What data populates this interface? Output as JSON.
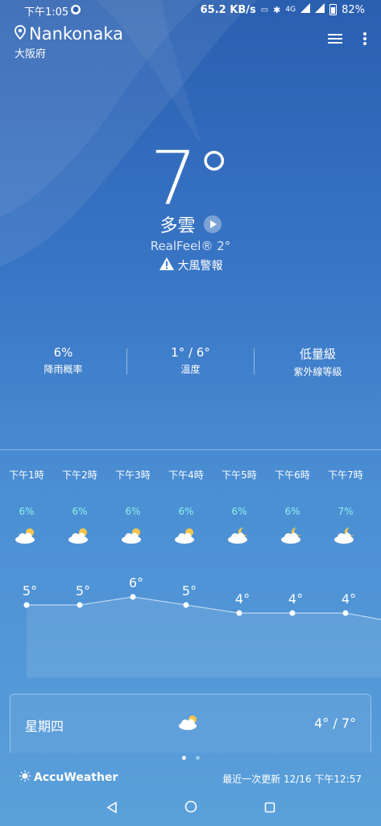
{
  "status_bar": {
    "time": "下午1:05",
    "net_speed": "65.2 KB/s",
    "signal_1": "4G",
    "battery": "82%"
  },
  "location": {
    "name": "Nankonaka",
    "region": "大阪府"
  },
  "current": {
    "temperature": "7°",
    "condition": "多雲",
    "realfeel": "RealFeel® 2°",
    "alert": "大風警報"
  },
  "stats": [
    {
      "value": "6%",
      "label": "降雨概率"
    },
    {
      "value": "1° / 6°",
      "label": "溫度"
    },
    {
      "value": "低量級",
      "label": "紫外線等級"
    }
  ],
  "hourly": [
    {
      "time": "下午1時",
      "precip": "6%",
      "icon": "partly-cloudy-day-icon",
      "temp": "5°",
      "value": 5
    },
    {
      "time": "下午2時",
      "precip": "6%",
      "icon": "partly-cloudy-day-icon",
      "temp": "5°",
      "value": 5
    },
    {
      "time": "下午3時",
      "precip": "6%",
      "icon": "partly-cloudy-day-icon",
      "temp": "6°",
      "value": 6
    },
    {
      "time": "下午4時",
      "precip": "6%",
      "icon": "partly-cloudy-day-icon",
      "temp": "5°",
      "value": 5
    },
    {
      "time": "下午5時",
      "precip": "6%",
      "icon": "partly-cloudy-night-icon",
      "temp": "4°",
      "value": 4
    },
    {
      "time": "下午6時",
      "precip": "6%",
      "icon": "partly-cloudy-night-icon",
      "temp": "4°",
      "value": 4
    },
    {
      "time": "下午7時",
      "precip": "7%",
      "icon": "partly-cloudy-night-icon",
      "temp": "4°",
      "value": 4
    }
  ],
  "daily": {
    "day": "星期四",
    "icon": "partly-cloudy-day-icon",
    "range": "4° / 7°"
  },
  "footer": {
    "brand": "AccuWeather",
    "updated": "最近一次更新 12/16 下午12:57"
  },
  "colors": {
    "precip": "#8ef0e8",
    "sun": "#f6c64b"
  }
}
